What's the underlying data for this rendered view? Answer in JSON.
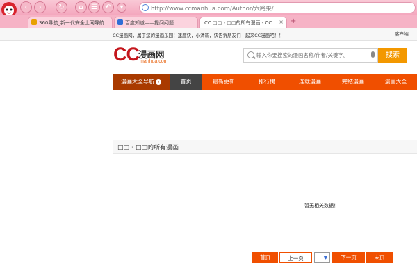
{
  "browser": {
    "url": "http://www.ccmanhua.com/Author/六路果/",
    "tabs": [
      {
        "label": "360导航_新一代安全上网导航",
        "active": false
      },
      {
        "label": "百度知道——提问问题",
        "active": false
      },
      {
        "label": "CC □□・□□的所有漫画 - CC",
        "active": true
      }
    ],
    "new_tab_symbol": "+"
  },
  "site": {
    "notice": "CC漫画网，属于您的漫画乐园！速度快，小清新，快告诉朋友们一起来CC漫画吧！！",
    "client_label": "客户端",
    "logo": {
      "cc": "CC",
      "name": "漫画网",
      "domain": "manhua.com"
    },
    "search": {
      "placeholder": "输入你要搜索的漫画名称/作者/关键字。",
      "button": "搜索"
    },
    "nav": [
      {
        "label": "漫画大全导航"
      },
      {
        "label": "首页"
      },
      {
        "label": "最新更新"
      },
      {
        "label": "排行榜"
      },
      {
        "label": "连载漫画"
      },
      {
        "label": "完结漫画"
      },
      {
        "label": "漫画大全"
      }
    ],
    "section_title": "□□・□□的所有漫画",
    "empty_message": "暂无相关数据！",
    "pagination": {
      "first": "首页",
      "prev": "上一页",
      "next": "下一页",
      "last": "末页"
    }
  },
  "colors": {
    "brand_red": "#c4161c",
    "nav_orange": "#f04f00",
    "search_orange": "#f39800"
  },
  "icons": [
    "avatar-icon",
    "back-icon",
    "forward-icon",
    "refresh-icon",
    "home-icon",
    "undo-icon",
    "dropdown-icon",
    "cloud-icon",
    "search-icon",
    "mic-icon"
  ]
}
